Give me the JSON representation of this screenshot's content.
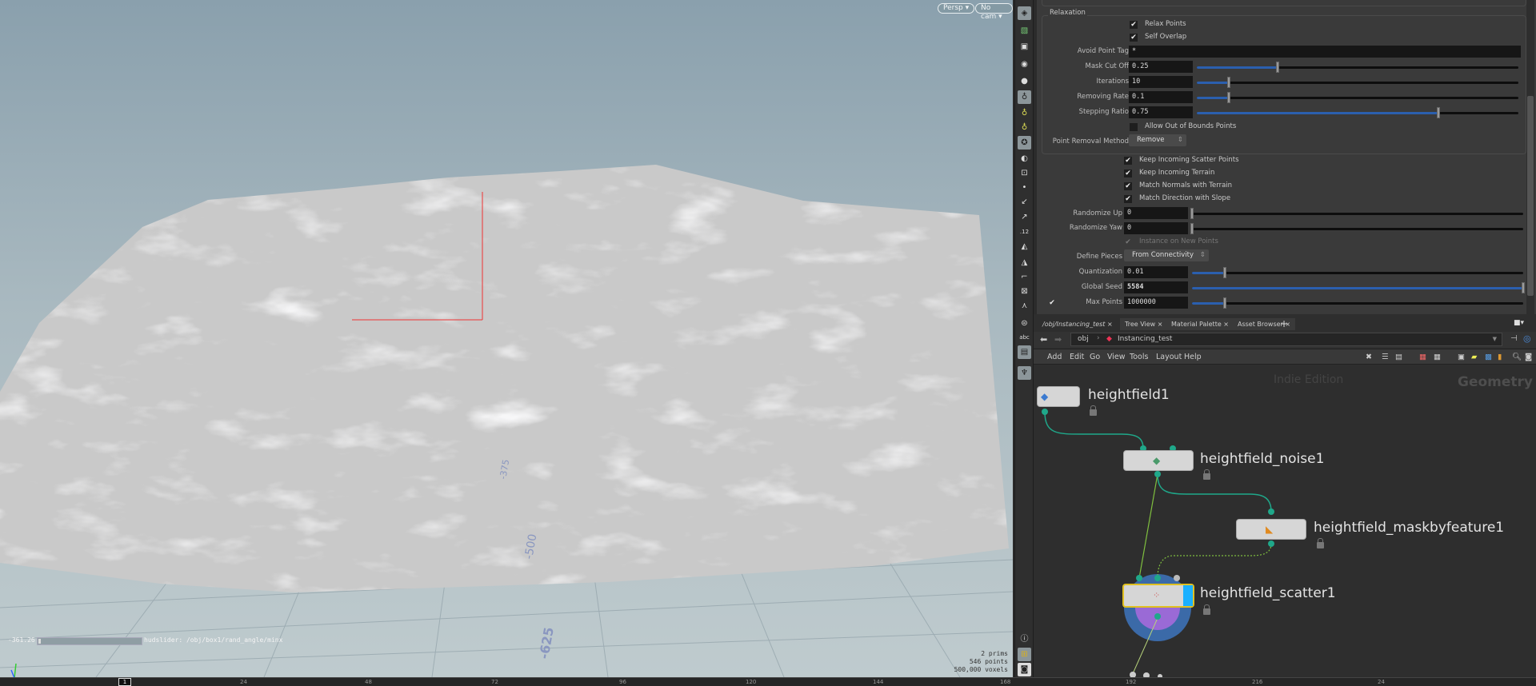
{
  "viewport": {
    "view_menu": "Persp",
    "camera_menu": "No cam",
    "hud_slider_value": "-361.26",
    "hud_slider_label": "hudslider: /obj/box1/rand_angle/minx",
    "grid_labels": [
      "-375",
      "-500",
      "-625"
    ],
    "stats": {
      "prims": "2  prims",
      "points": "546 points",
      "voxels": "500,000 voxels"
    },
    "axis": {
      "x": "x",
      "y": "y"
    }
  },
  "params": {
    "relaxation": {
      "title": "Relaxation",
      "relax_points": {
        "label": "Relax Points",
        "checked": true
      },
      "self_overlap": {
        "label": "Self Overlap",
        "checked": true
      },
      "avoid_point_tag": {
        "label": "Avoid Point Tag",
        "value": "*"
      },
      "mask_cut_off": {
        "label": "Mask Cut Off",
        "value": "0.25",
        "fraction": 0.25
      },
      "iterations": {
        "label": "Iterations",
        "value": "10",
        "fraction": 0.1
      },
      "removing_rate": {
        "label": "Removing Rate",
        "value": "0.1",
        "fraction": 0.1
      },
      "stepping_ratio": {
        "label": "Stepping Ratio",
        "value": "0.75",
        "fraction": 0.75
      },
      "allow_out_of_bounds": {
        "label": "Allow Out of Bounds Points",
        "checked": false
      },
      "point_removal_method": {
        "label": "Point Removal Method",
        "value": "Remove"
      }
    },
    "keep_incoming_scatter": {
      "label": "Keep Incoming Scatter Points",
      "checked": true
    },
    "keep_incoming_terrain": {
      "label": "Keep Incoming Terrain",
      "checked": true
    },
    "match_normals": {
      "label": "Match Normals with Terrain",
      "checked": true
    },
    "match_direction": {
      "label": "Match Direction with Slope",
      "checked": true
    },
    "randomize_up": {
      "label": "Randomize Up",
      "value": "0",
      "fraction": 0
    },
    "randomize_yaw": {
      "label": "Randomize Yaw",
      "value": "0",
      "fraction": 0
    },
    "instance_on_new_points": {
      "label": "Instance on New Points",
      "checked": true,
      "disabled": true
    },
    "define_pieces": {
      "label": "Define Pieces",
      "value": "From Connectivity"
    },
    "quantization": {
      "label": "Quantization",
      "value": "0.01",
      "fraction": 0.1
    },
    "global_seed": {
      "label": "Global Seed",
      "value": "5584",
      "fraction": 1.0
    },
    "max_points": {
      "label": "Max Points",
      "value": "1000000",
      "fraction": 0.1,
      "enabled": true
    }
  },
  "network": {
    "tabs": [
      "/obj/Instancing_test",
      "Tree View",
      "Material Palette",
      "Asset Browser"
    ],
    "path": [
      "obj",
      "Instancing_test"
    ],
    "menu": [
      "Add",
      "Edit",
      "Go",
      "View",
      "Tools",
      "Layout",
      "Help"
    ],
    "watermark": "Indie Edition",
    "context": "Geometry",
    "nodes": [
      "heightfield1",
      "heightfield_noise1",
      "heightfield_maskbyfeature1",
      "heightfield_scatter1"
    ]
  },
  "timeline": {
    "current_frame": "1",
    "ticks": [
      "24",
      "48",
      "72",
      "96",
      "120",
      "144",
      "168",
      "192",
      "216",
      "24"
    ]
  },
  "colors": {
    "wire": "#1fa88a",
    "selected": "#e0c020",
    "slider": "#2b5fae",
    "display_flag": "#1ab0ff"
  }
}
